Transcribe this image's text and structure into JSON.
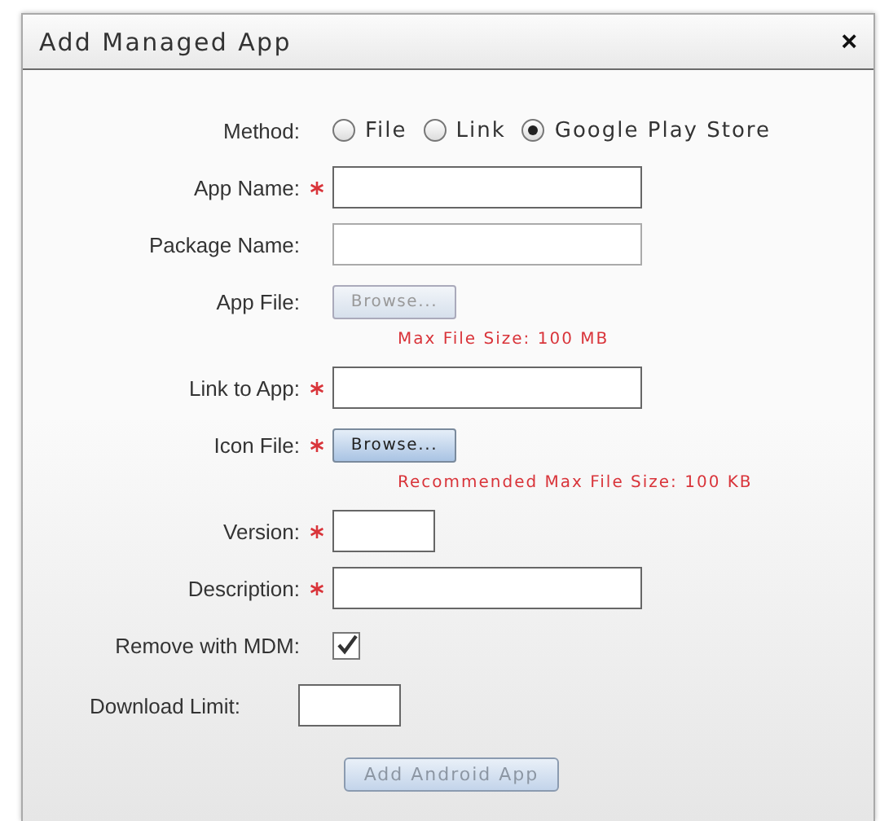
{
  "dialog": {
    "title": "Add Managed App",
    "close": "×"
  },
  "fields": [
    {
      "kind": "radio",
      "label": "Method:",
      "required": false,
      "options": [
        {
          "label": "File",
          "selected": false
        },
        {
          "label": "Link",
          "selected": false
        },
        {
          "label": "Google Play Store",
          "selected": true
        }
      ]
    },
    {
      "kind": "text",
      "label": "App Name:",
      "required": true,
      "disabled": false
    },
    {
      "kind": "text",
      "label": "Package Name:",
      "required": false,
      "disabled": true
    },
    {
      "kind": "file",
      "label": "App File:",
      "required": false,
      "disabled": true,
      "button": "Browse...",
      "note": "Max File Size: 100 MB"
    },
    {
      "kind": "text",
      "label": "Link to App:",
      "required": true,
      "disabled": false
    },
    {
      "kind": "file",
      "label": "Icon File:",
      "required": true,
      "disabled": false,
      "button": "Browse...",
      "note": "Recommended Max File Size: 100 KB"
    },
    {
      "kind": "short-text",
      "label": "Version:",
      "required": true,
      "disabled": false
    },
    {
      "kind": "text",
      "label": "Description:",
      "required": true,
      "disabled": false
    },
    {
      "kind": "checkbox",
      "label": "Remove with MDM:",
      "required": false,
      "checked": true
    },
    {
      "kind": "inline-text",
      "label": "Download Limit:",
      "required": false,
      "disabled": false
    }
  ],
  "submit": {
    "label": "Add Android App",
    "disabled": true
  }
}
